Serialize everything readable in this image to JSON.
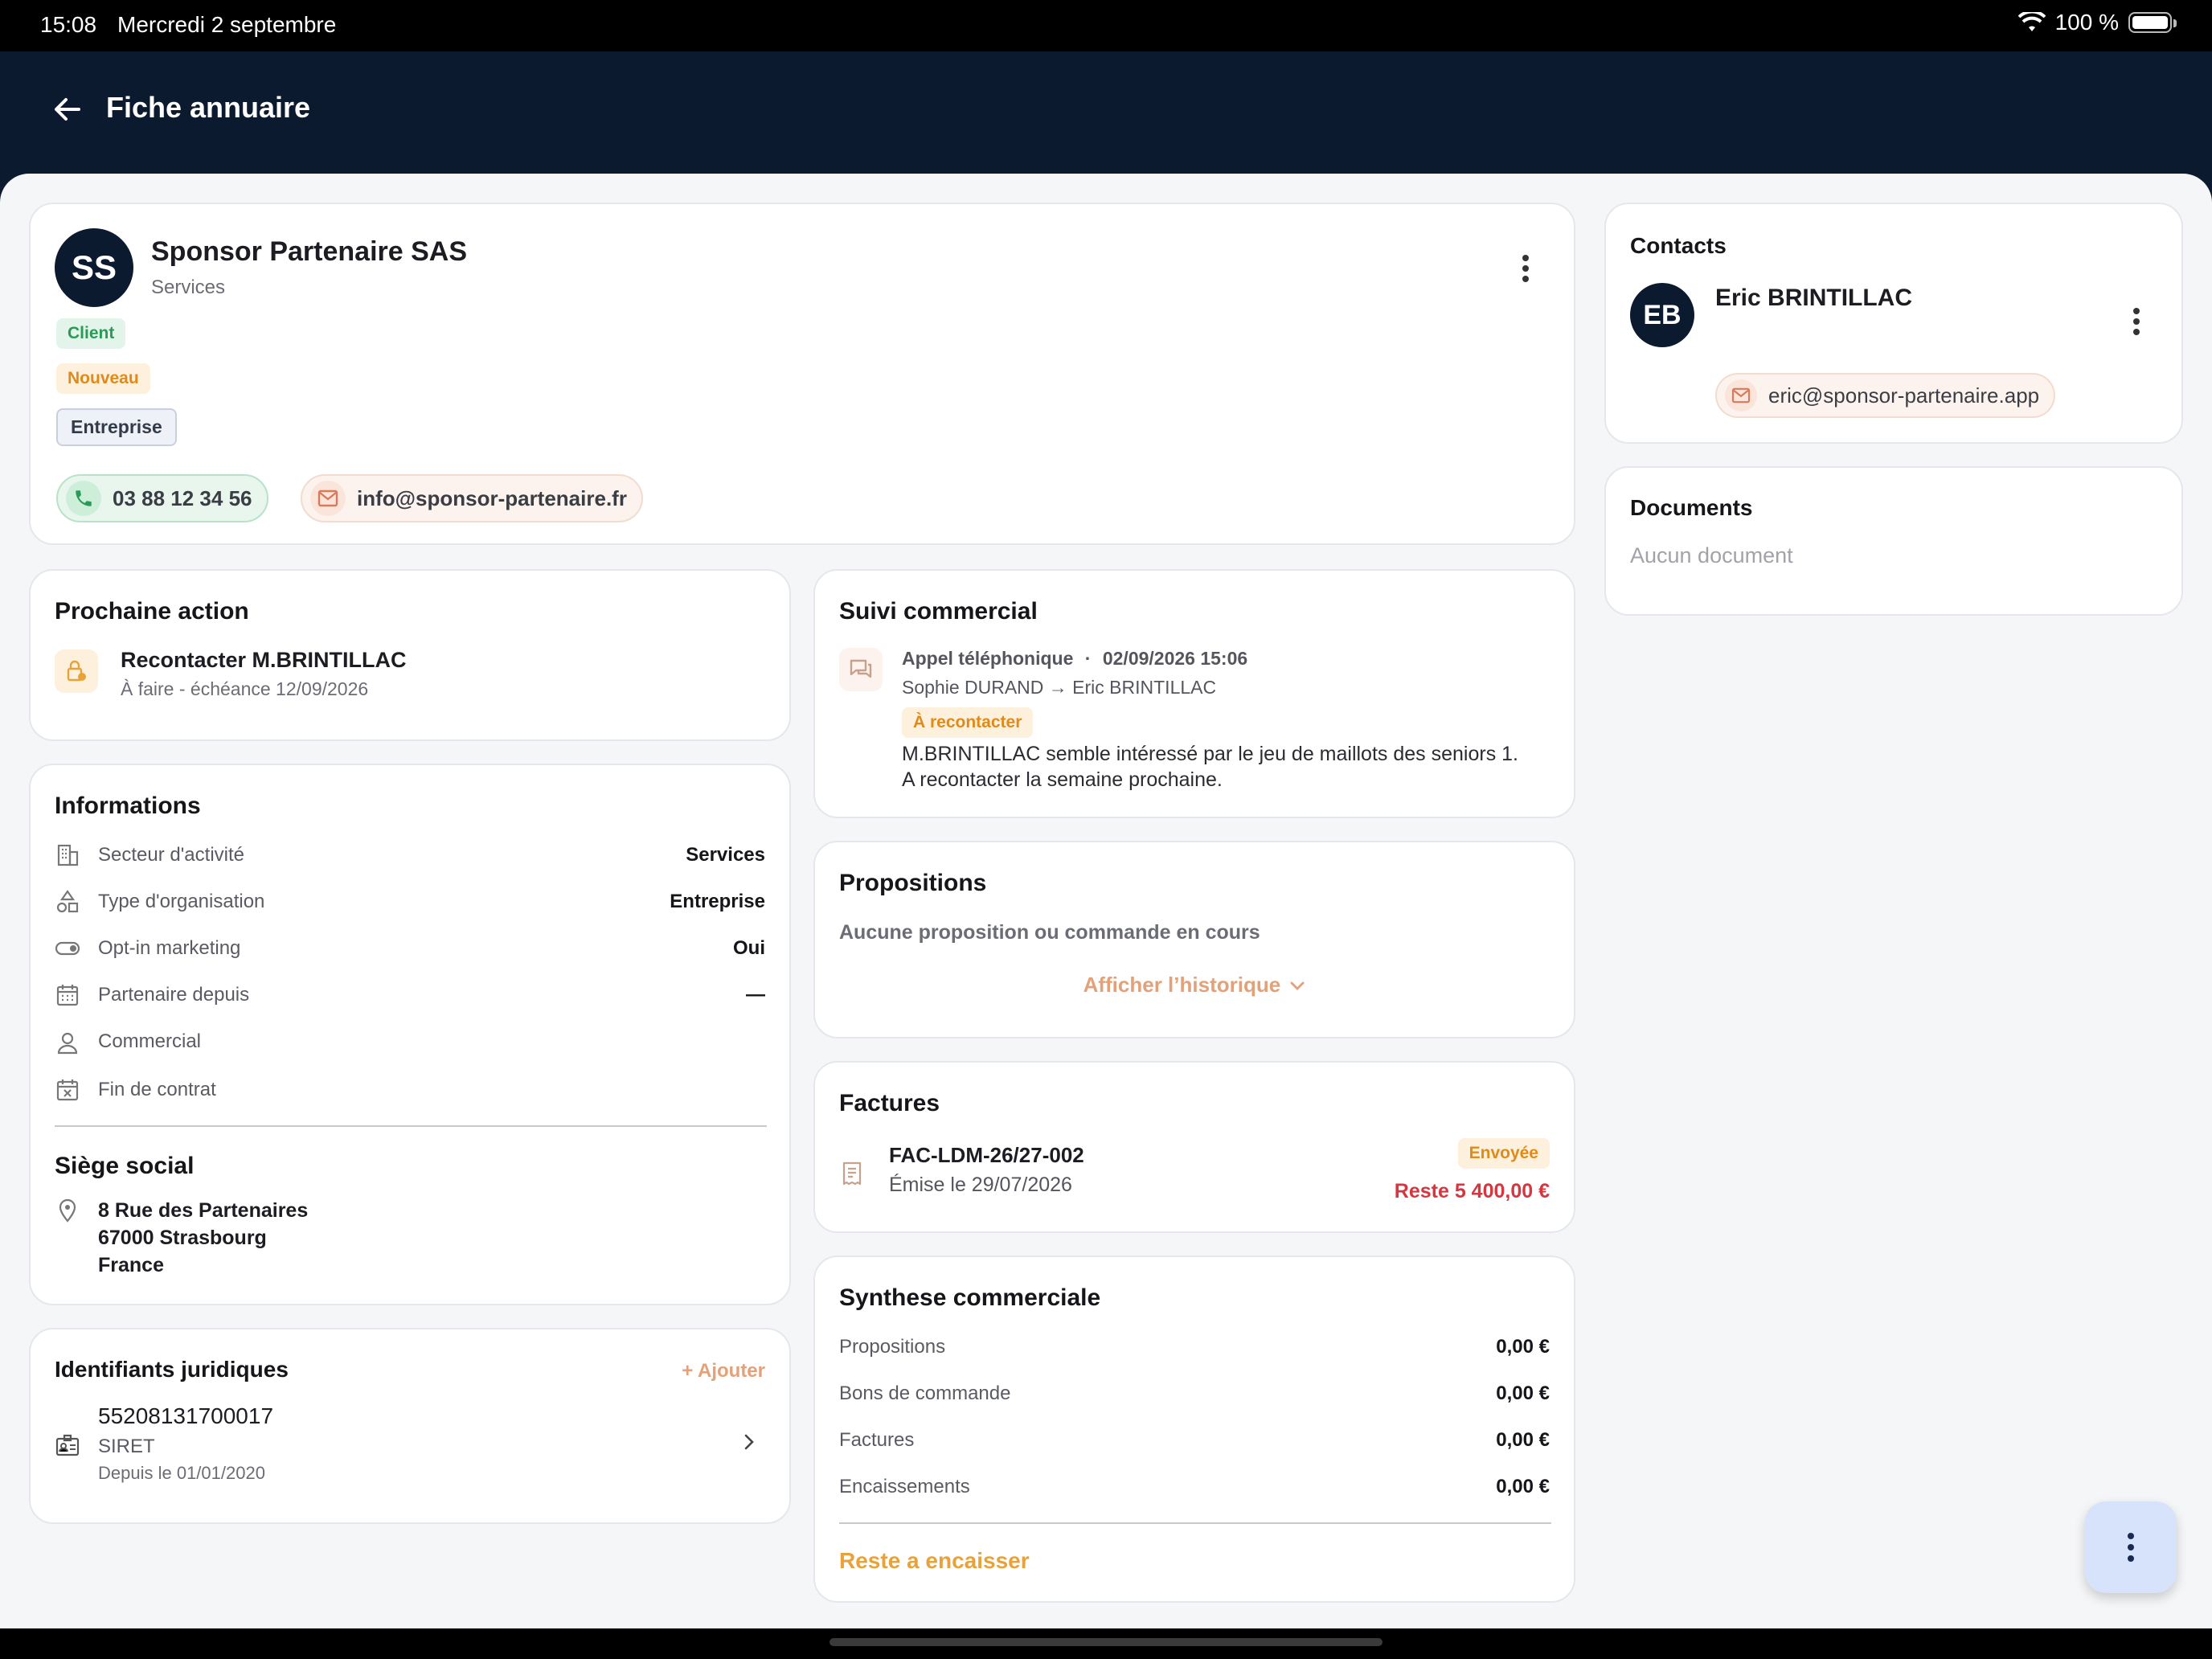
{
  "status_bar": {
    "time": "15:08",
    "date": "Mercredi 2 septembre",
    "battery": "100 %"
  },
  "app_bar": {
    "title": "Fiche annuaire"
  },
  "company": {
    "initials": "SS",
    "name": "Sponsor Partenaire SAS",
    "sector": "Services",
    "tags": {
      "client": "Client",
      "nouveau": "Nouveau",
      "entreprise": "Entreprise"
    },
    "phone": "03 88 12 34 56",
    "email": "info@sponsor-partenaire.fr"
  },
  "contacts": {
    "title": "Contacts",
    "items": [
      {
        "initials": "EB",
        "name": "Eric BRINTILLAC",
        "email": "eric@sponsor-partenaire.app"
      }
    ]
  },
  "documents": {
    "title": "Documents",
    "empty": "Aucun document"
  },
  "next_action": {
    "title": "Prochaine action",
    "task": "Recontacter M.BRINTILLAC",
    "status": "À faire - échéance 12/09/2026"
  },
  "informations": {
    "title": "Informations",
    "rows": [
      {
        "label": "Secteur d'activité",
        "value": "Services",
        "icon": "building-icon"
      },
      {
        "label": "Type d'organisation",
        "value": "Entreprise",
        "icon": "shapes-icon"
      },
      {
        "label": "Opt-in marketing",
        "value": "Oui",
        "icon": "toggle-icon"
      },
      {
        "label": "Partenaire depuis",
        "value": "—",
        "icon": "calendar-icon"
      },
      {
        "label": "Commercial",
        "value": "",
        "icon": "person-icon"
      },
      {
        "label": "Fin de contrat",
        "value": "",
        "icon": "calendar-x-icon"
      }
    ]
  },
  "siege": {
    "title": "Siège social",
    "line1": "8 Rue des Partenaires",
    "line2": "67000 Strasbourg",
    "line3": "France"
  },
  "legal_ids": {
    "title": "Identifiants juridiques",
    "add_label": "+ Ajouter",
    "items": [
      {
        "number": "55208131700017",
        "type": "SIRET",
        "since": "Depuis le 01/01/2020"
      }
    ]
  },
  "suivi": {
    "title": "Suivi commercial",
    "entry": {
      "kind": "Appel téléphonique",
      "separator": "·",
      "datetime": "02/09/2026 15:06",
      "from_to": "Sophie DURAND → Eric BRINTILLAC",
      "badge": "À recontacter",
      "note_line1": "M.BRINTILLAC semble intéressé par le jeu de maillots des seniors 1.",
      "note_line2": "A recontacter la semaine prochaine."
    }
  },
  "propositions": {
    "title": "Propositions",
    "empty": "Aucune proposition ou commande en cours",
    "history_link": "Afficher l’historique"
  },
  "factures": {
    "title": "Factures",
    "items": [
      {
        "number": "FAC-LDM-26/27-002",
        "issued": "Émise le 29/07/2026",
        "status": "Envoyée",
        "remaining": "Reste 5 400,00 €"
      }
    ]
  },
  "synthese": {
    "title": "Synthese commerciale",
    "rows": [
      {
        "label": "Propositions",
        "value": "0,00 €"
      },
      {
        "label": "Bons de commande",
        "value": "0,00 €"
      },
      {
        "label": "Factures",
        "value": "0,00 €"
      },
      {
        "label": "Encaissements",
        "value": "0,00 €"
      }
    ],
    "total_label": "Reste a encaisser"
  },
  "colors": {
    "navy": "#0b1a2e",
    "accent_orange": "#e8a23a",
    "danger": "#d6363e",
    "success": "#2a9a57"
  }
}
